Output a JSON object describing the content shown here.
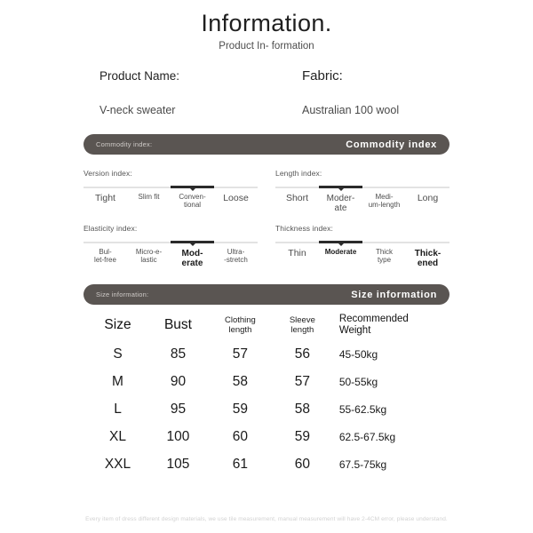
{
  "header": {
    "title": "Information.",
    "subtitle": "Product In-\nformation"
  },
  "product": {
    "name_label": "Product Name:",
    "name_value": "V-neck sweater",
    "fabric_label": "Fabric:",
    "fabric_value": "Australian 100 wool"
  },
  "commodity_banner": {
    "left_label": "Commodity index:",
    "right_label": "Commodity index"
  },
  "size_banner": {
    "left_label": "Size information:",
    "right_label": "Size information"
  },
  "scales": [
    {
      "title": "Version index:",
      "labels": [
        "Tight",
        "Slim fit",
        "Conven-\ntional",
        "Loose"
      ],
      "selected": 2
    },
    {
      "title": "Length index:",
      "labels": [
        "Short",
        "Moder-\nate",
        "Medi-\num-length",
        "Long"
      ],
      "selected": 1
    },
    {
      "title": "Elasticity index:",
      "labels": [
        "Bul-\nlet-free",
        "Micro-e-\nlastic",
        "Mod-\nerate",
        "Ultra-\n-stretch"
      ],
      "selected": 2
    },
    {
      "title": "Thickness index:",
      "labels": [
        "Thin",
        "Moderate",
        "Thick\ntype",
        "Thick-\nened"
      ],
      "selected": 1
    }
  ],
  "size_table": {
    "headers": {
      "size": "Size",
      "bust": "Bust",
      "clothing_length": "Clothing\nlength",
      "sleeve_length": "Sleeve\nlength",
      "recommended_weight": "Recommended\nWeight"
    },
    "rows": [
      {
        "size": "S",
        "bust": "85",
        "clothing_length": "57",
        "sleeve_length": "56",
        "recommended_weight": "45-50kg"
      },
      {
        "size": "M",
        "bust": "90",
        "clothing_length": "58",
        "sleeve_length": "57",
        "recommended_weight": "50-55kg"
      },
      {
        "size": "L",
        "bust": "95",
        "clothing_length": "59",
        "sleeve_length": "58",
        "recommended_weight": "55-62.5kg"
      },
      {
        "size": "XL",
        "bust": "100",
        "clothing_length": "60",
        "sleeve_length": "59",
        "recommended_weight": "62.5-67.5kg"
      },
      {
        "size": "XXL",
        "bust": "105",
        "clothing_length": "61",
        "sleeve_length": "60",
        "recommended_weight": "67.5-75kg"
      }
    ]
  },
  "footer": {
    "disclaimer": "Every item of dress different design materials, we use tile measurement, manual measurement will have 2-4CM error, please understand."
  },
  "colors": {
    "banner_bg": "#5a5552",
    "banner_text": "#ffffff",
    "track": "#e3e3e3",
    "track_active": "#2b2b2b",
    "body_text": "#3a3a3a"
  }
}
